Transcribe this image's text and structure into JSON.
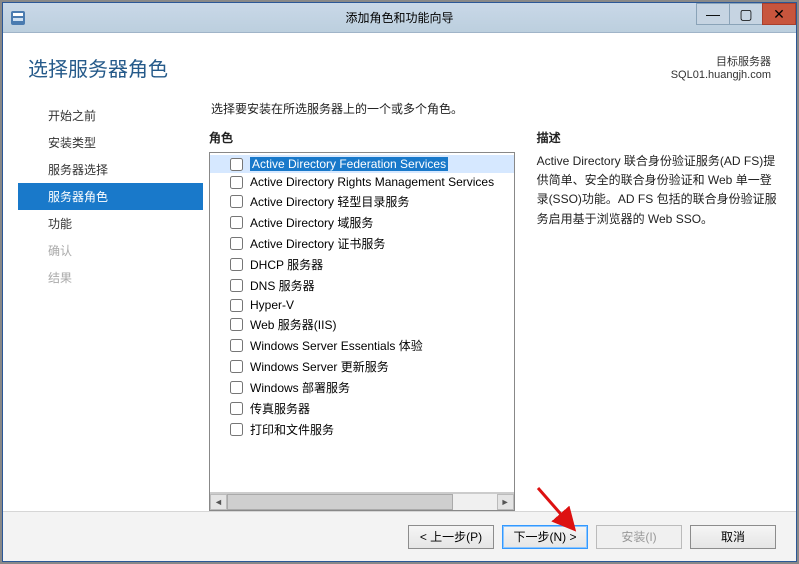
{
  "window": {
    "title": "添加角色和功能向导"
  },
  "header": {
    "page_title": "选择服务器角色",
    "dest_label": "目标服务器",
    "dest_server": "SQL01.huangjh.com"
  },
  "sidebar": {
    "items": [
      {
        "label": "开始之前",
        "state": "normal"
      },
      {
        "label": "安装类型",
        "state": "normal"
      },
      {
        "label": "服务器选择",
        "state": "normal"
      },
      {
        "label": "服务器角色",
        "state": "active"
      },
      {
        "label": "功能",
        "state": "normal"
      },
      {
        "label": "确认",
        "state": "disabled"
      },
      {
        "label": "结果",
        "state": "disabled"
      }
    ]
  },
  "main": {
    "instruction": "选择要安装在所选服务器上的一个或多个角色。",
    "roles_header": "角色",
    "desc_header": "描述",
    "description": "Active Directory 联合身份验证服务(AD FS)提供简单、安全的联合身份验证和 Web 单一登录(SSO)功能。AD FS 包括的联合身份验证服务启用基于浏览器的 Web SSO。",
    "roles": [
      {
        "label": "Active Directory Federation Services",
        "checked": false,
        "selected": true
      },
      {
        "label": "Active Directory Rights Management Services",
        "checked": false,
        "selected": false
      },
      {
        "label": "Active Directory 轻型目录服务",
        "checked": false,
        "selected": false
      },
      {
        "label": "Active Directory 域服务",
        "checked": false,
        "selected": false
      },
      {
        "label": "Active Directory 证书服务",
        "checked": false,
        "selected": false
      },
      {
        "label": "DHCP 服务器",
        "checked": false,
        "selected": false
      },
      {
        "label": "DNS 服务器",
        "checked": false,
        "selected": false
      },
      {
        "label": "Hyper-V",
        "checked": false,
        "selected": false
      },
      {
        "label": "Web 服务器(IIS)",
        "checked": false,
        "selected": false
      },
      {
        "label": "Windows Server Essentials 体验",
        "checked": false,
        "selected": false
      },
      {
        "label": "Windows Server 更新服务",
        "checked": false,
        "selected": false
      },
      {
        "label": "Windows 部署服务",
        "checked": false,
        "selected": false
      },
      {
        "label": "传真服务器",
        "checked": false,
        "selected": false
      },
      {
        "label": "打印和文件服务",
        "checked": false,
        "selected": false
      }
    ]
  },
  "footer": {
    "prev": "< 上一步(P)",
    "next": "下一步(N) >",
    "install": "安装(I)",
    "cancel": "取消"
  }
}
